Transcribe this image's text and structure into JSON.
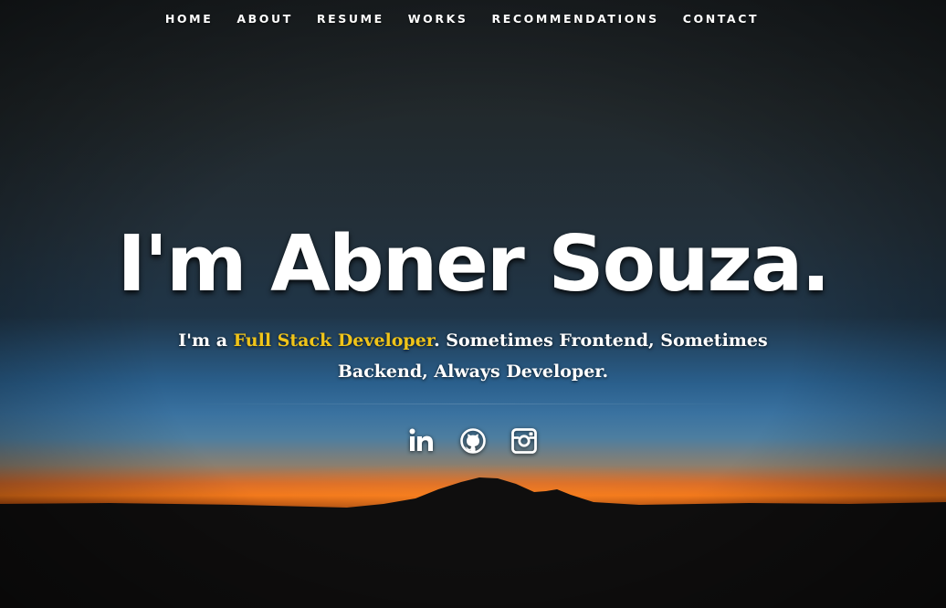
{
  "nav": {
    "items": [
      {
        "label": "HOME"
      },
      {
        "label": "ABOUT"
      },
      {
        "label": "RESUME"
      },
      {
        "label": "WORKS"
      },
      {
        "label": "RECOMMENDATIONS"
      },
      {
        "label": "CONTACT"
      }
    ]
  },
  "banner": {
    "headline": "I'm Abner Souza.",
    "tagline_prefix": "I'm a ",
    "tagline_highlight": "Full Stack Developer",
    "tagline_suffix": ". Sometimes Frontend, Sometimes Backend, Always Developer.",
    "highlight_color": "#f0c419"
  },
  "social": {
    "icons": [
      "linkedin-icon",
      "github-icon",
      "instagram-icon"
    ]
  }
}
